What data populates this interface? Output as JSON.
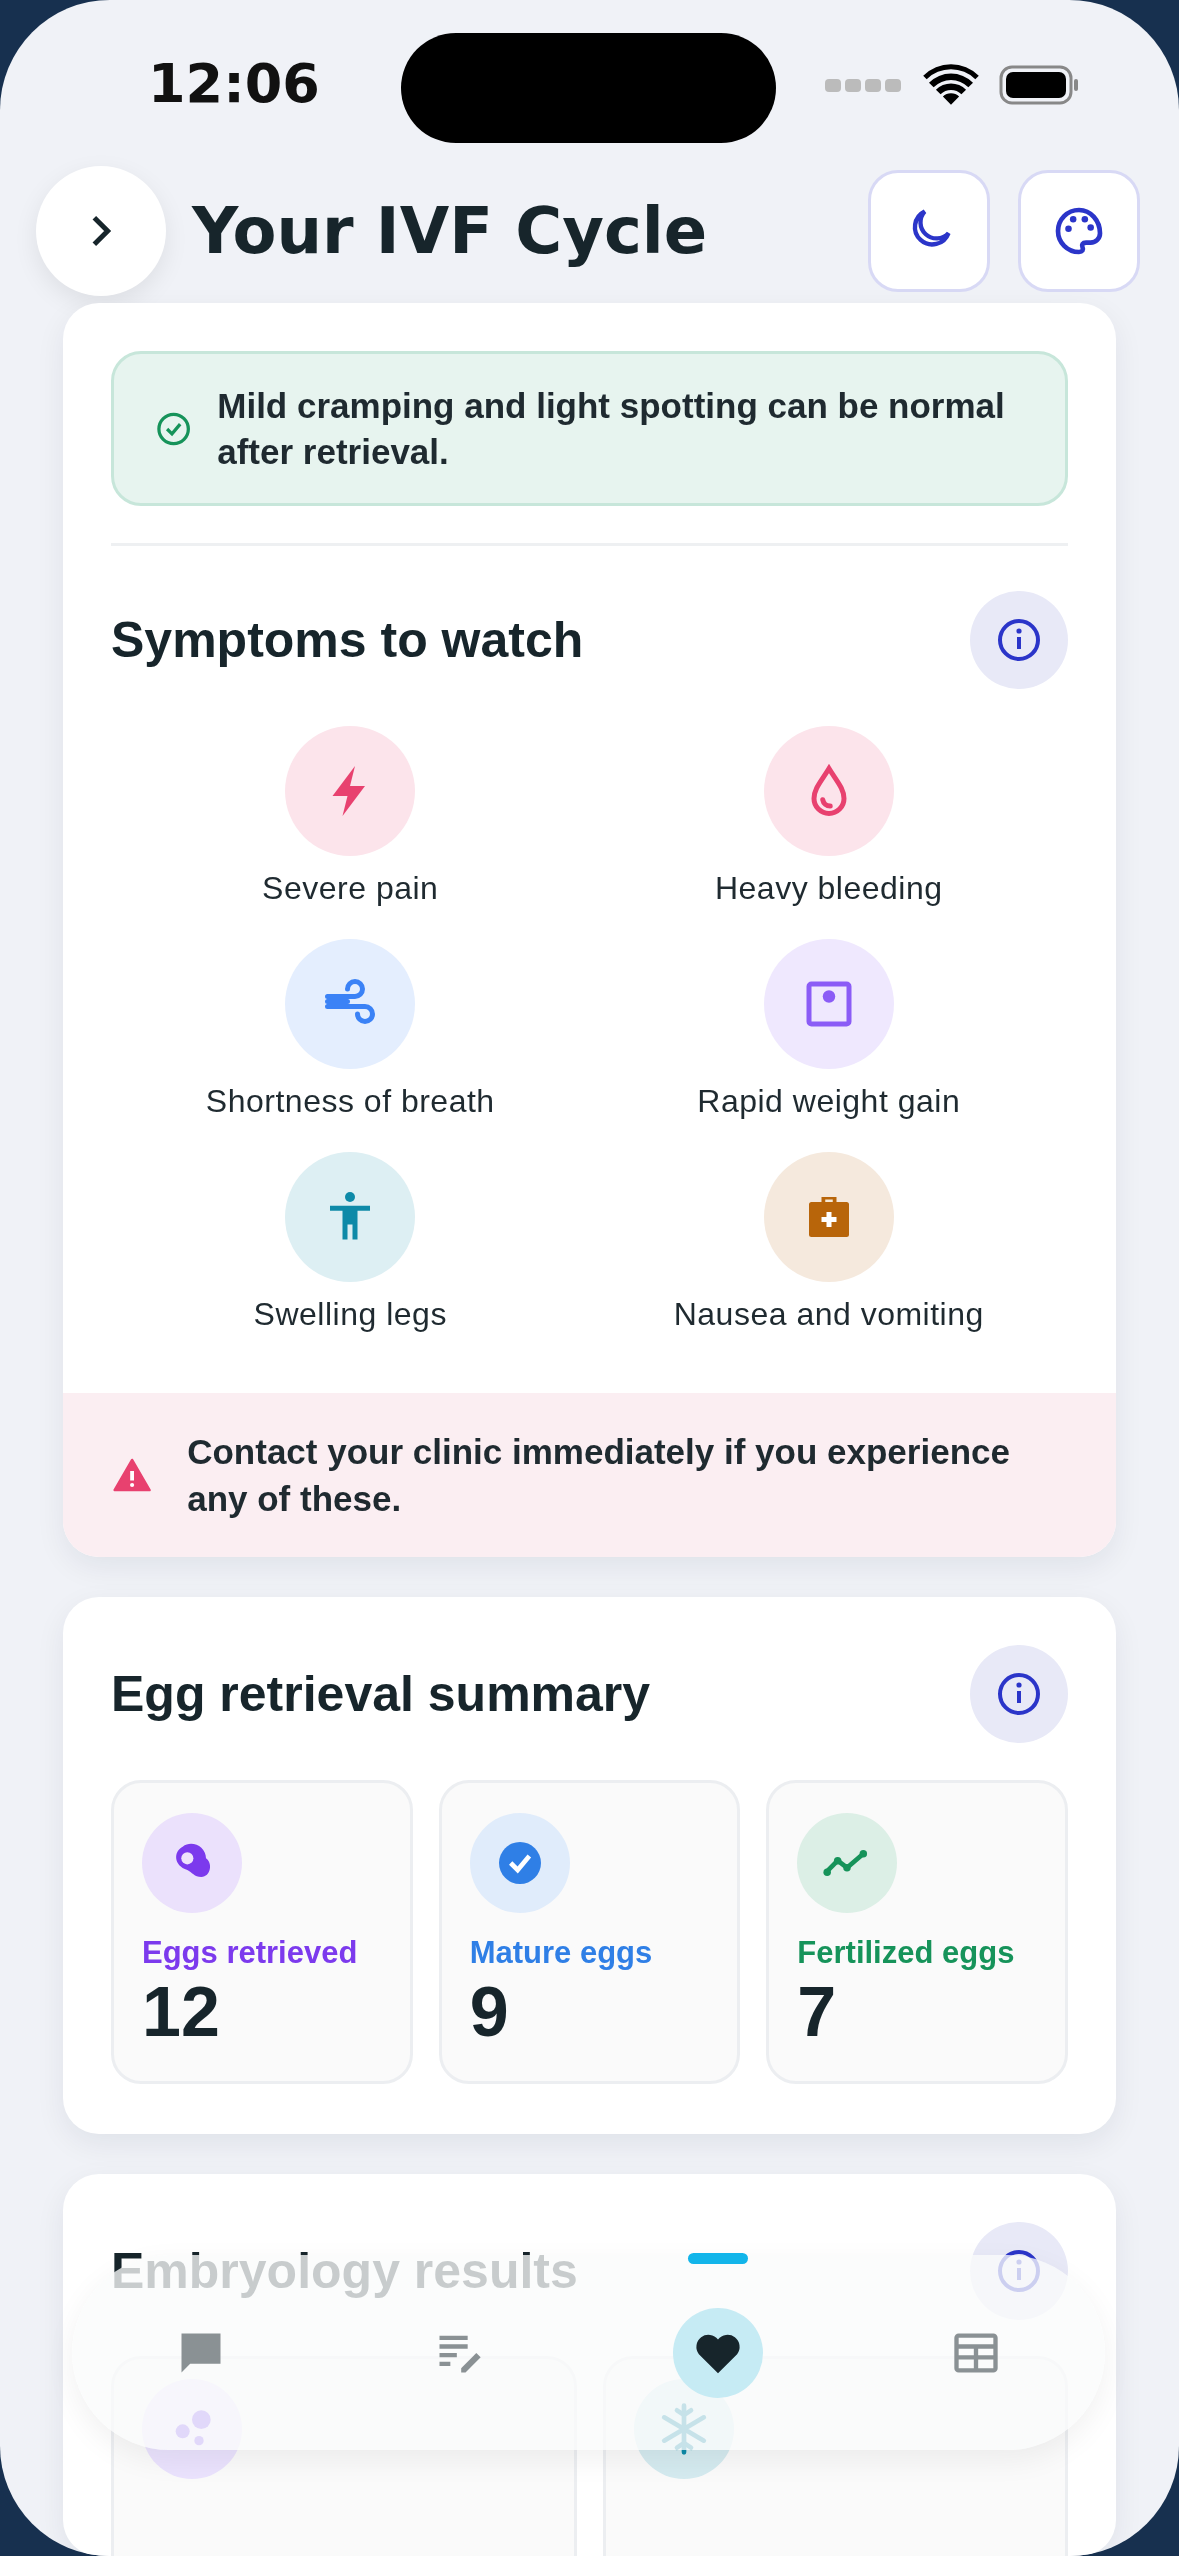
{
  "status_bar": {
    "time": "12:06"
  },
  "header": {
    "title": "Your IVF Cycle"
  },
  "notice": {
    "text": "Mild cramping and light spotting can be normal after retrieval."
  },
  "symptoms": {
    "title": "Symptoms to watch",
    "items": [
      {
        "label": "Severe pain",
        "kind": "bolt",
        "color": "#e8416f"
      },
      {
        "label": "Heavy bleeding",
        "kind": "drop",
        "color": "#e8416f"
      },
      {
        "label": "Shortness of breath",
        "kind": "wind",
        "color": "#3b82f6"
      },
      {
        "label": "Rapid weight gain",
        "kind": "scale",
        "color": "#8b5cf6"
      },
      {
        "label": "Swelling legs",
        "kind": "body",
        "color": "#0e8aa8"
      },
      {
        "label": "Nausea and vomiting",
        "kind": "kit",
        "color": "#b8650a"
      }
    ],
    "warning": "Contact your clinic immediately if you experience any of these."
  },
  "summary": {
    "title": "Egg retrieval summary",
    "stats": [
      {
        "label": "Eggs retrieved",
        "value": "12",
        "kind": "egg",
        "color": "#7c3aed"
      },
      {
        "label": "Mature eggs",
        "value": "9",
        "kind": "check",
        "color": "#2f7fe6"
      },
      {
        "label": "Fertilized eggs",
        "value": "7",
        "kind": "trend",
        "color": "#16935a"
      }
    ]
  },
  "embryology": {
    "title": "Embryology results",
    "boxes": [
      {
        "kind": "dots"
      },
      {
        "kind": "snow"
      }
    ]
  },
  "nav": [
    {
      "kind": "chat",
      "selected": false
    },
    {
      "kind": "edit",
      "selected": false
    },
    {
      "kind": "heart",
      "selected": true
    },
    {
      "kind": "table",
      "selected": false
    }
  ]
}
